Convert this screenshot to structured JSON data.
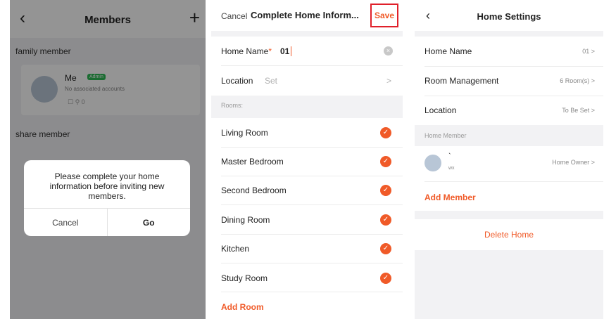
{
  "members_screen": {
    "back_icon": "‹",
    "title": "Members",
    "add_icon": "+",
    "family_section": "family member",
    "member": {
      "name": "Me",
      "badge": "Admin",
      "subtitle": "No associated accounts",
      "icons": "☐   ⚲ 0"
    },
    "share_section": "share member",
    "dialog": {
      "message": "Please complete your home information before inviting new members.",
      "cancel": "Cancel",
      "go": "Go"
    }
  },
  "home_info_screen": {
    "cancel": "Cancel",
    "title": "Complete Home Inform...",
    "save": "Save",
    "home_name_label": "Home Name",
    "required_mark": "*",
    "home_name_value": "01",
    "clear_icon": "×",
    "location_label": "Location",
    "location_value": "Set",
    "arrow": ">",
    "rooms_label": "Rooms:",
    "rooms": [
      "Living Room",
      "Master Bedroom",
      "Second Bedroom",
      "Dining Room",
      "Kitchen",
      "Study Room"
    ],
    "check_icon": "✓",
    "add_room": "Add Room"
  },
  "home_settings_screen": {
    "back_icon": "‹",
    "title": "Home Settings",
    "home_name_label": "Home Name",
    "home_name_value": "01 >",
    "room_mgmt_label": "Room Management",
    "room_mgmt_value": "6 Room(s) >",
    "location_label": "Location",
    "location_value": "To Be Set >",
    "member_section": "Home Member",
    "member_name": "`",
    "member_sub": "wx",
    "member_role": "Home Owner >",
    "add_member": "Add Member",
    "delete_home": "Delete Home"
  },
  "colors": {
    "accent": "#f05a28",
    "highlight_box": "#e0202a",
    "background": "#f2f2f4"
  }
}
